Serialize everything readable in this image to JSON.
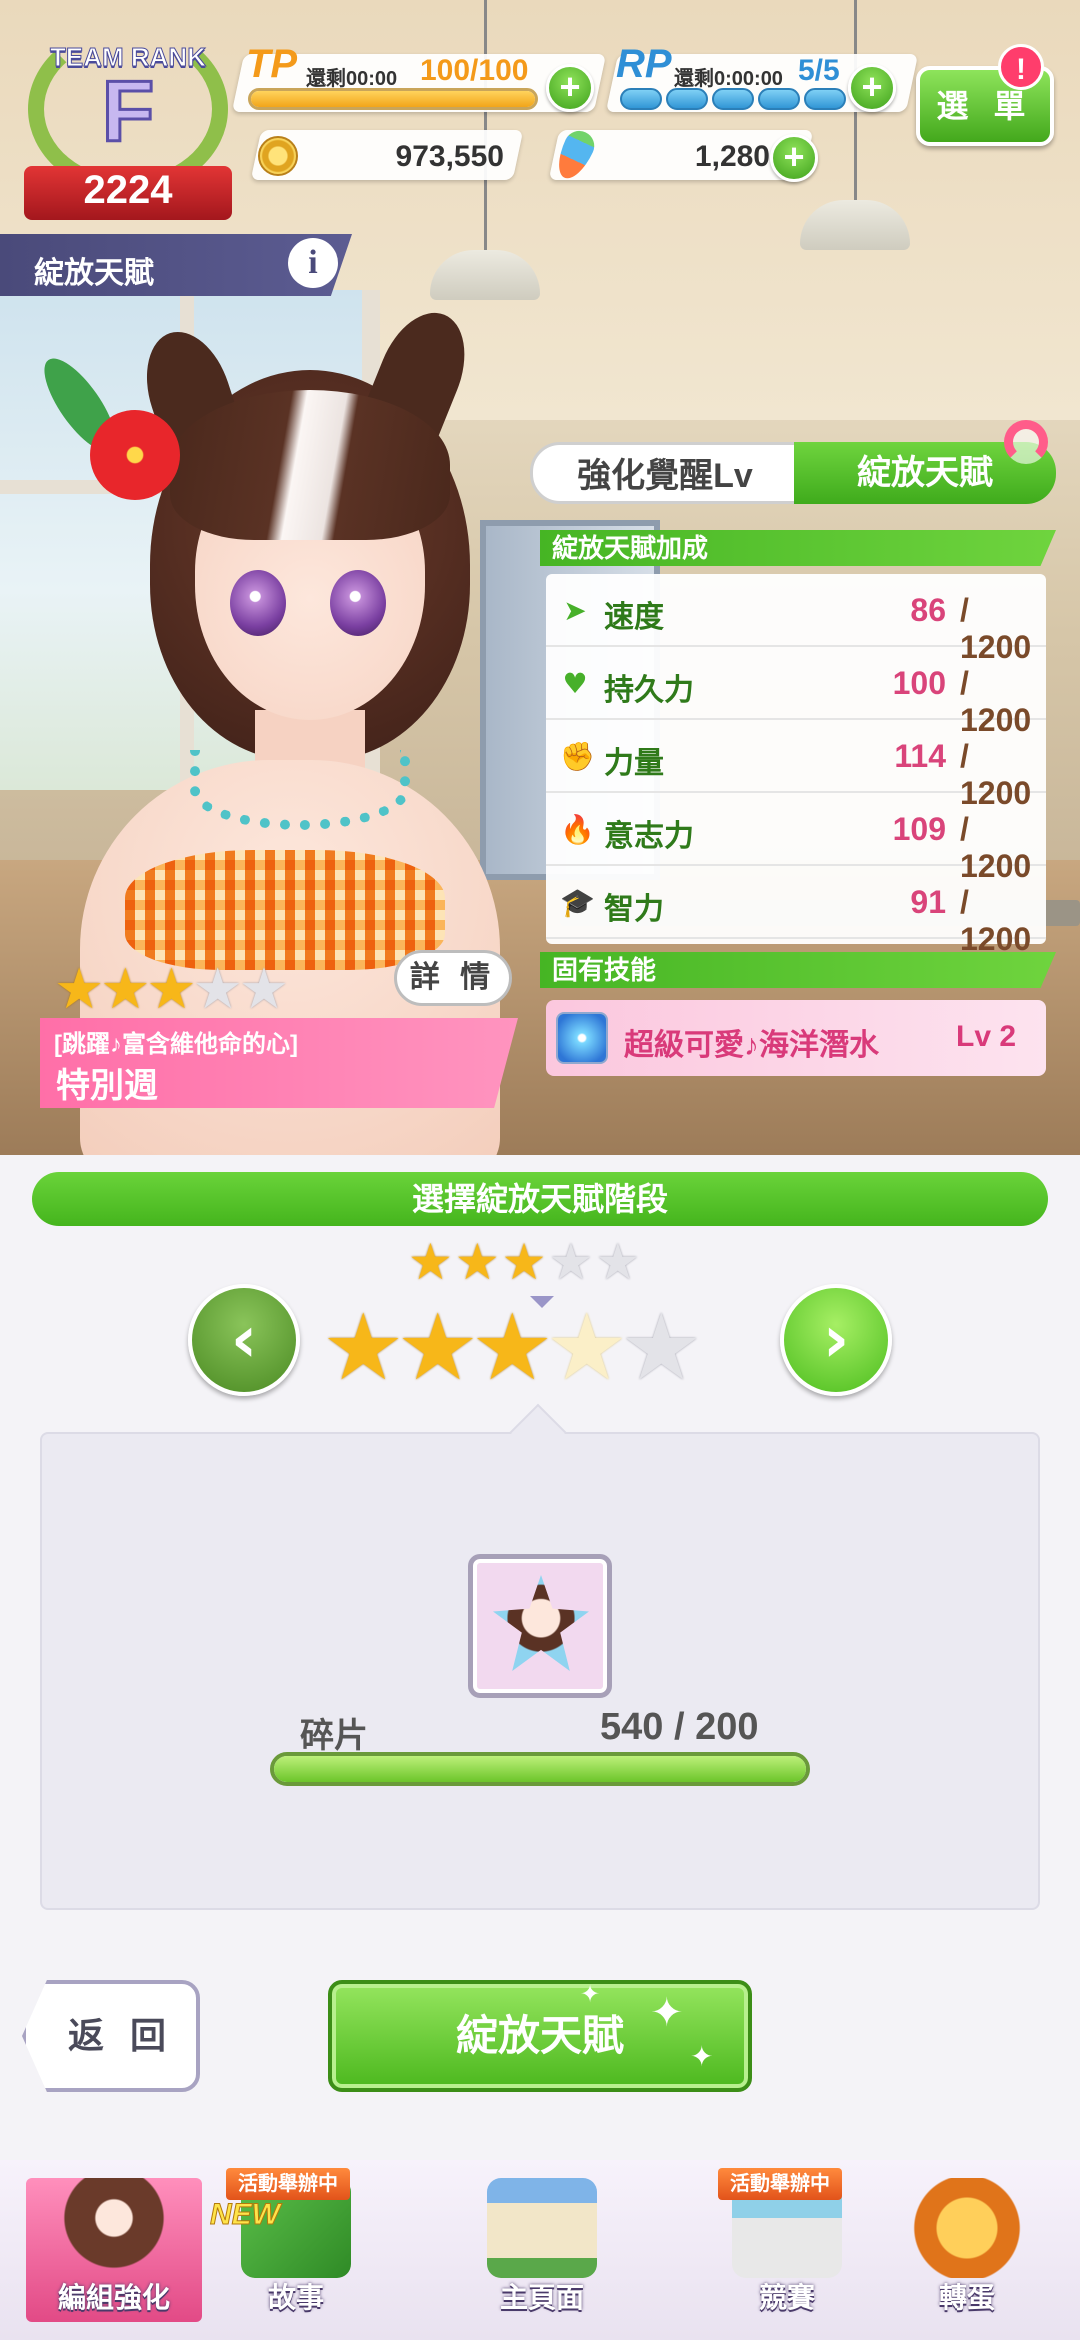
{
  "header": {
    "team_rank": {
      "title": "TEAM RANK",
      "letter": "F",
      "score": "2224"
    },
    "tp": {
      "label": "TP",
      "timer": "還剩00:00",
      "value": "100/100",
      "fill": 1.0
    },
    "rp": {
      "label": "RP",
      "timer": "還剩0:00:00",
      "value": "5/5",
      "pills": 5
    },
    "coins": "973,550",
    "carrots": "1,280",
    "menu_label": "選 單",
    "menu_alert": "!"
  },
  "section": {
    "title": "綻放天賦",
    "info": "i"
  },
  "tabs": {
    "left": "強化覺醒Lv",
    "right": "綻放天賦"
  },
  "stats": {
    "header": "綻放天賦加成",
    "rows": [
      {
        "icon": "shoe-icon",
        "glyph": "➤",
        "name": "速度",
        "value": "86",
        "max": "/ 1200"
      },
      {
        "icon": "heart-icon",
        "glyph": "♥",
        "name": "持久力",
        "value": "100",
        "max": "/ 1200"
      },
      {
        "icon": "arm-icon",
        "glyph": "✊",
        "name": "力量",
        "value": "114",
        "max": "/ 1200"
      },
      {
        "icon": "flame-icon",
        "glyph": "🔥",
        "name": "意志力",
        "value": "109",
        "max": "/ 1200"
      },
      {
        "icon": "graduation-cap-icon",
        "glyph": "🎓",
        "name": "智力",
        "value": "91",
        "max": "/ 1200"
      }
    ]
  },
  "skill": {
    "header": "固有技能",
    "name": "超級可愛♪海洋潛水",
    "level": "Lv 2"
  },
  "character": {
    "stars": 3,
    "max_stars": 5,
    "detail_label": "詳 情",
    "title": "[跳躍♪富含維他命的心]",
    "name": "特別週"
  },
  "select": {
    "bar_label": "選擇綻放天賦階段",
    "small_stars": 3,
    "big_stars": 3,
    "faint_star": 4,
    "total_stars": 5
  },
  "shards": {
    "label": "碎片",
    "count": "540 / 200",
    "fill": 1.0
  },
  "buttons": {
    "back": "返 回",
    "bloom": "綻放天賦"
  },
  "nav": [
    {
      "name": "nav-team",
      "label": "編組強化",
      "active": true,
      "event": ""
    },
    {
      "name": "nav-story",
      "label": "故事",
      "active": false,
      "event": "活動舉辦中",
      "new": "NEW"
    },
    {
      "name": "nav-home",
      "label": "主頁面",
      "active": false,
      "event": ""
    },
    {
      "name": "nav-race",
      "label": "競賽",
      "active": false,
      "event": "活動舉辦中"
    },
    {
      "name": "nav-gacha",
      "label": "轉蛋",
      "active": false,
      "event": ""
    }
  ],
  "colors": {
    "accent_green": "#4cb81e",
    "pink": "#e24a86",
    "stat_value": "#d9447a",
    "hud_purple": "#4a4a7a"
  }
}
